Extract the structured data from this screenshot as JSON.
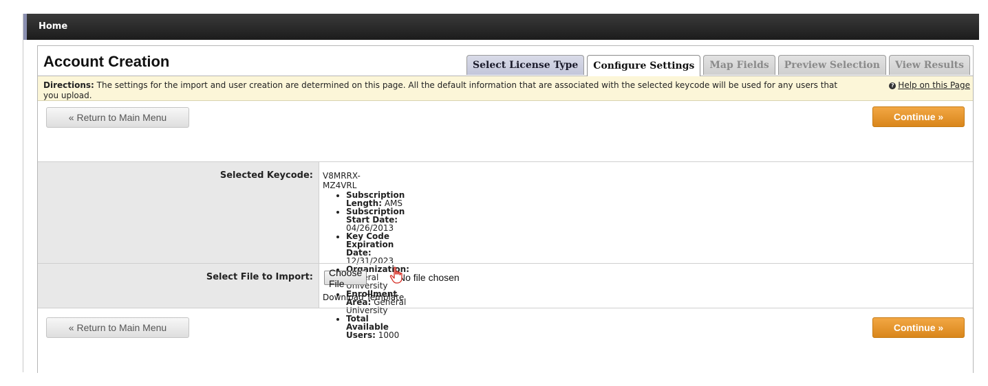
{
  "header": {
    "home_label": "Home"
  },
  "page": {
    "title": "Account Creation"
  },
  "tabs": [
    {
      "label": "Select License Type",
      "state": "done"
    },
    {
      "label": "Configure Settings",
      "state": "active"
    },
    {
      "label": "Map Fields",
      "state": "disabled"
    },
    {
      "label": "Preview Selection",
      "state": "disabled"
    },
    {
      "label": "View Results",
      "state": "disabled"
    }
  ],
  "directions": {
    "label": "Directions:",
    "text": " The settings for the import and user creation are determined on this page. All the default information that are associated with the selected keycode will be used for any users that you upload.",
    "help_link": "Help on this Page",
    "help_icon": "question-circle-icon"
  },
  "actions": {
    "return_label": "« Return to Main Menu",
    "continue_label": "Continue »"
  },
  "form": {
    "keycode_label": "Selected Keycode:",
    "keycode_value": "V8MRRX-MZ4VRL",
    "details": [
      {
        "label": "Subscription Length:",
        "value": " AMS"
      },
      {
        "label": "Subscription Start Date:",
        "value": " 04/26/2013"
      },
      {
        "label": "Key Code Expiration Date:",
        "value": " 12/31/2023"
      },
      {
        "label": "Organization:",
        "value": " General University"
      },
      {
        "label": "Enrollment Area:",
        "value": " General University"
      },
      {
        "label": "Total Available Users:",
        "value": " 1000"
      }
    ],
    "file_label": "Select File to Import:",
    "choose_file_label": "Choose File",
    "file_status": "No file chosen",
    "download_template": "Download Template"
  },
  "colors": {
    "accent_orange": "#e3921f",
    "directions_bg": "#fcf6d8",
    "home_bar": "#262626"
  }
}
